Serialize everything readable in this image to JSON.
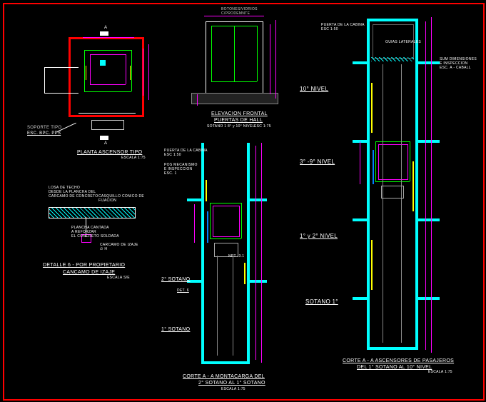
{
  "plan": {
    "title": "PLANTA ASCENSOR TIPO",
    "scale": "ESCALA  1:75",
    "section_mark": "A",
    "note_label": "SOPORTE TIPO",
    "note_detail": "ESC. BPC. PPS"
  },
  "elevation": {
    "header": "BOTONES/VIDRIOS",
    "header2": "C/PRODEMNTE",
    "title": "ELEVACION FRONTAL",
    "subtitle": "PUERTAS DE HALL",
    "range": "SOTANO 1  8° y 10° NIVEL",
    "scale": "ESC 1:75"
  },
  "section_left": {
    "label_door": "PUERTA DE LA CABINA",
    "label_door_scale": "ESC 1:50",
    "label_motor": "POS MECANISMO",
    "label_motor2": "E INSPECCION",
    "label_motor3": "ESC. 1",
    "level2": "2° SOTANO",
    "det": "DET. 6",
    "level1": "1° SOTANO",
    "title": "CORTE A - A  MONTACARGA DEL",
    "subtitle": "2° SOTANO AL 1° SOTANO",
    "scale": "ESCALA 1:75",
    "dim_label": "NPT -3.1"
  },
  "section_right": {
    "label_door": "PUERTA DE LA CABINA",
    "label_door2": "ESC 1:50",
    "label_rail": "GUIAS LATERALES",
    "level10": "10° NIVEL",
    "level3": "3° -9° NIVEL",
    "level1_2": "1° y 2° NIVEL",
    "levelS1": "SOTANO 1°",
    "title": "CORTE A - A  ASCENSORES DE PASAJEROS",
    "subtitle": "DEL 1° SOTANO AL 10° NIVEL",
    "scale": "ESCALA 1:75",
    "label_side": "SUM DIMENSIONES",
    "label_side2": "E INSPECCION",
    "label_side3": "ESC. A - CABALL"
  },
  "detail6": {
    "note1": "LOSA DE TECHO",
    "note2": "DESDE LA PLANCHA DEL",
    "note3": "CARCAMO DE CONCRETO",
    "note4": "CASQUILLO CONICO DE",
    "note5": "FIJACION",
    "note6": "PLANCHA CANTADA",
    "note7": "A REFORZAR",
    "note8": "EL CONCRETO SOLDADA",
    "rod": "CARCAMO DE IZAJE",
    "rod2": "∅ H",
    "title": "DETALLE  6 - POR PROPIETARIO",
    "subtitle": "CANCAMO DE IZAJE",
    "scale": "ESCALA  S/E"
  }
}
